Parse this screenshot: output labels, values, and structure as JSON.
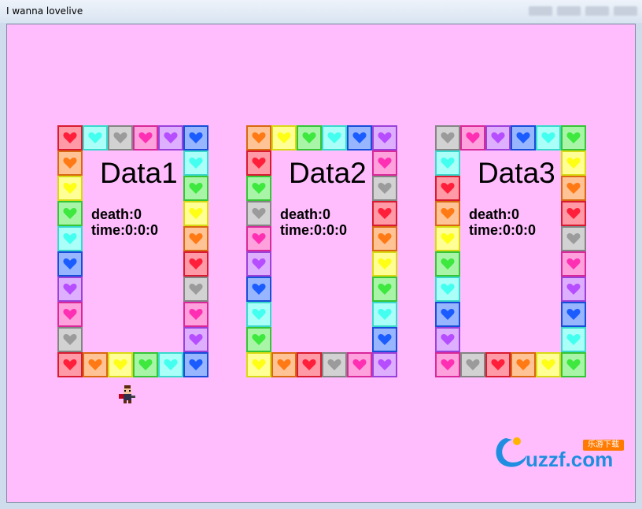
{
  "window": {
    "title": "I wanna lovelive",
    "controls_blurred": [
      "",
      "",
      "",
      ""
    ]
  },
  "colors": {
    "background": "#ffbdfe",
    "red": "#ff1f3a",
    "orange": "#ff7a14",
    "yellow": "#ffff16",
    "green": "#3ee83e",
    "cyan": "#42fff0",
    "blue": "#1b5cff",
    "purple": "#b64dff",
    "pink": "#ff2fb4",
    "gray": "#9b9b9b"
  },
  "slots": [
    {
      "title": "Data1",
      "death": "death:0",
      "time": "time:0:0:0",
      "top": [
        "red",
        "cyan",
        "gray",
        "pink",
        "purple",
        "blue"
      ],
      "left": [
        "orange",
        "yellow",
        "green",
        "cyan",
        "blue",
        "purple",
        "pink",
        "gray"
      ],
      "right": [
        "cyan",
        "green",
        "yellow",
        "orange",
        "red",
        "gray",
        "pink",
        "purple"
      ],
      "bottom": [
        "red",
        "orange",
        "yellow",
        "green",
        "cyan",
        "blue"
      ]
    },
    {
      "title": "Data2",
      "death": "death:0",
      "time": "time:0:0:0",
      "top": [
        "orange",
        "yellow",
        "green",
        "cyan",
        "blue",
        "purple"
      ],
      "left": [
        "red",
        "green",
        "gray",
        "pink",
        "purple",
        "blue",
        "cyan",
        "green"
      ],
      "right": [
        "pink",
        "gray",
        "red",
        "orange",
        "yellow",
        "green",
        "cyan",
        "blue"
      ],
      "bottom": [
        "yellow",
        "orange",
        "red",
        "gray",
        "pink",
        "purple"
      ]
    },
    {
      "title": "Data3",
      "death": "death:0",
      "time": "time:0:0:0",
      "top": [
        "gray",
        "pink",
        "purple",
        "blue",
        "cyan",
        "green"
      ],
      "left": [
        "cyan",
        "red",
        "orange",
        "yellow",
        "green",
        "cyan",
        "blue",
        "purple"
      ],
      "right": [
        "yellow",
        "orange",
        "red",
        "gray",
        "pink",
        "purple",
        "blue",
        "cyan"
      ],
      "bottom": [
        "pink",
        "gray",
        "red",
        "orange",
        "yellow",
        "green"
      ]
    }
  ],
  "player": {
    "icon": "kid-sprite-icon"
  },
  "watermark": {
    "text": "uzzf.com",
    "badge": "乐游下载"
  }
}
